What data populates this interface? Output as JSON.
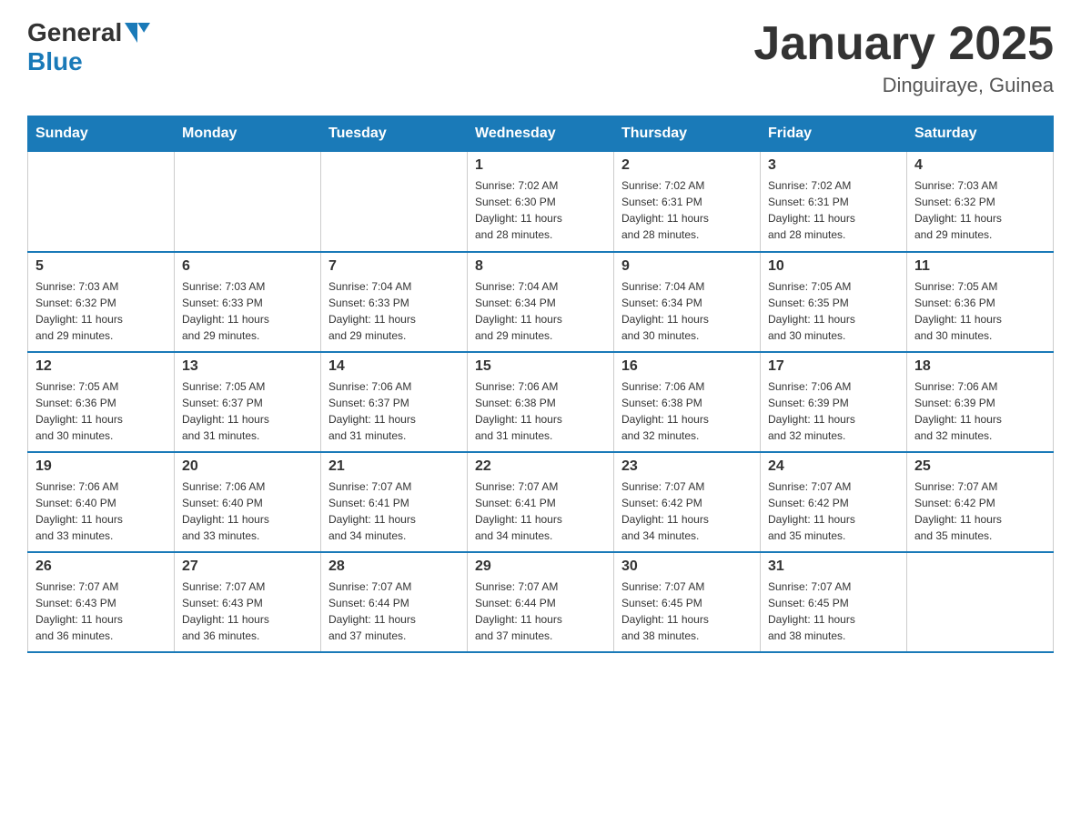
{
  "header": {
    "logo_general": "General",
    "logo_blue": "Blue",
    "title": "January 2025",
    "subtitle": "Dinguiraye, Guinea"
  },
  "days_of_week": [
    "Sunday",
    "Monday",
    "Tuesday",
    "Wednesday",
    "Thursday",
    "Friday",
    "Saturday"
  ],
  "weeks": [
    [
      {
        "day": "",
        "info": ""
      },
      {
        "day": "",
        "info": ""
      },
      {
        "day": "",
        "info": ""
      },
      {
        "day": "1",
        "info": "Sunrise: 7:02 AM\nSunset: 6:30 PM\nDaylight: 11 hours\nand 28 minutes."
      },
      {
        "day": "2",
        "info": "Sunrise: 7:02 AM\nSunset: 6:31 PM\nDaylight: 11 hours\nand 28 minutes."
      },
      {
        "day": "3",
        "info": "Sunrise: 7:02 AM\nSunset: 6:31 PM\nDaylight: 11 hours\nand 28 minutes."
      },
      {
        "day": "4",
        "info": "Sunrise: 7:03 AM\nSunset: 6:32 PM\nDaylight: 11 hours\nand 29 minutes."
      }
    ],
    [
      {
        "day": "5",
        "info": "Sunrise: 7:03 AM\nSunset: 6:32 PM\nDaylight: 11 hours\nand 29 minutes."
      },
      {
        "day": "6",
        "info": "Sunrise: 7:03 AM\nSunset: 6:33 PM\nDaylight: 11 hours\nand 29 minutes."
      },
      {
        "day": "7",
        "info": "Sunrise: 7:04 AM\nSunset: 6:33 PM\nDaylight: 11 hours\nand 29 minutes."
      },
      {
        "day": "8",
        "info": "Sunrise: 7:04 AM\nSunset: 6:34 PM\nDaylight: 11 hours\nand 29 minutes."
      },
      {
        "day": "9",
        "info": "Sunrise: 7:04 AM\nSunset: 6:34 PM\nDaylight: 11 hours\nand 30 minutes."
      },
      {
        "day": "10",
        "info": "Sunrise: 7:05 AM\nSunset: 6:35 PM\nDaylight: 11 hours\nand 30 minutes."
      },
      {
        "day": "11",
        "info": "Sunrise: 7:05 AM\nSunset: 6:36 PM\nDaylight: 11 hours\nand 30 minutes."
      }
    ],
    [
      {
        "day": "12",
        "info": "Sunrise: 7:05 AM\nSunset: 6:36 PM\nDaylight: 11 hours\nand 30 minutes."
      },
      {
        "day": "13",
        "info": "Sunrise: 7:05 AM\nSunset: 6:37 PM\nDaylight: 11 hours\nand 31 minutes."
      },
      {
        "day": "14",
        "info": "Sunrise: 7:06 AM\nSunset: 6:37 PM\nDaylight: 11 hours\nand 31 minutes."
      },
      {
        "day": "15",
        "info": "Sunrise: 7:06 AM\nSunset: 6:38 PM\nDaylight: 11 hours\nand 31 minutes."
      },
      {
        "day": "16",
        "info": "Sunrise: 7:06 AM\nSunset: 6:38 PM\nDaylight: 11 hours\nand 32 minutes."
      },
      {
        "day": "17",
        "info": "Sunrise: 7:06 AM\nSunset: 6:39 PM\nDaylight: 11 hours\nand 32 minutes."
      },
      {
        "day": "18",
        "info": "Sunrise: 7:06 AM\nSunset: 6:39 PM\nDaylight: 11 hours\nand 32 minutes."
      }
    ],
    [
      {
        "day": "19",
        "info": "Sunrise: 7:06 AM\nSunset: 6:40 PM\nDaylight: 11 hours\nand 33 minutes."
      },
      {
        "day": "20",
        "info": "Sunrise: 7:06 AM\nSunset: 6:40 PM\nDaylight: 11 hours\nand 33 minutes."
      },
      {
        "day": "21",
        "info": "Sunrise: 7:07 AM\nSunset: 6:41 PM\nDaylight: 11 hours\nand 34 minutes."
      },
      {
        "day": "22",
        "info": "Sunrise: 7:07 AM\nSunset: 6:41 PM\nDaylight: 11 hours\nand 34 minutes."
      },
      {
        "day": "23",
        "info": "Sunrise: 7:07 AM\nSunset: 6:42 PM\nDaylight: 11 hours\nand 34 minutes."
      },
      {
        "day": "24",
        "info": "Sunrise: 7:07 AM\nSunset: 6:42 PM\nDaylight: 11 hours\nand 35 minutes."
      },
      {
        "day": "25",
        "info": "Sunrise: 7:07 AM\nSunset: 6:42 PM\nDaylight: 11 hours\nand 35 minutes."
      }
    ],
    [
      {
        "day": "26",
        "info": "Sunrise: 7:07 AM\nSunset: 6:43 PM\nDaylight: 11 hours\nand 36 minutes."
      },
      {
        "day": "27",
        "info": "Sunrise: 7:07 AM\nSunset: 6:43 PM\nDaylight: 11 hours\nand 36 minutes."
      },
      {
        "day": "28",
        "info": "Sunrise: 7:07 AM\nSunset: 6:44 PM\nDaylight: 11 hours\nand 37 minutes."
      },
      {
        "day": "29",
        "info": "Sunrise: 7:07 AM\nSunset: 6:44 PM\nDaylight: 11 hours\nand 37 minutes."
      },
      {
        "day": "30",
        "info": "Sunrise: 7:07 AM\nSunset: 6:45 PM\nDaylight: 11 hours\nand 38 minutes."
      },
      {
        "day": "31",
        "info": "Sunrise: 7:07 AM\nSunset: 6:45 PM\nDaylight: 11 hours\nand 38 minutes."
      },
      {
        "day": "",
        "info": ""
      }
    ]
  ]
}
